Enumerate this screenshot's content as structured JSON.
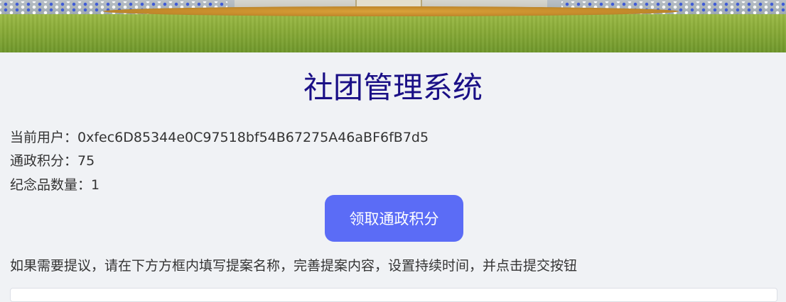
{
  "header": {
    "title": "社团管理系统"
  },
  "account": {
    "user_label": "当前用户：",
    "user_value": "0xfec6D85344e0C97518bf54B67275A46aBF6fB7d5",
    "points_label": "通政积分：",
    "points_value": "75",
    "souvenir_label": "纪念品数量：",
    "souvenir_value": "1"
  },
  "actions": {
    "claim_label": "领取通政积分"
  },
  "proposal": {
    "hint": "如果需要提议，请在下方方框内填写提案名称，完善提案内容，设置持续时间，并点击提交按钮"
  },
  "colors": {
    "title": "#1a0f86",
    "button": "#5b6cf6",
    "background": "#f0f2f5"
  }
}
